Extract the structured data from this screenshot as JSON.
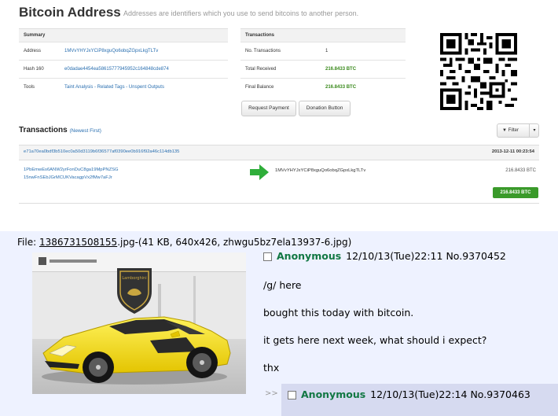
{
  "btc": {
    "title": "Bitcoin Address",
    "subtitle": "Addresses are identifiers which you use to send bitcoins to another person.",
    "summary": {
      "header": "Summary",
      "rows": [
        {
          "label": "Address",
          "value": "1MVvYHYJxYCiP8xguQo6obqZGpxLkgTLTv"
        },
        {
          "label": "Hash 160",
          "value": "e0dadae4454ea58615777945952c164848cde874"
        },
        {
          "label": "Tools",
          "value": "Taint Analysis - Related Tags - Unspent Outputs"
        }
      ]
    },
    "transactions_summary": {
      "header": "Transactions",
      "rows": [
        {
          "label": "No. Transactions",
          "value": "1"
        },
        {
          "label": "Total Received",
          "value": "216.8433 BTC"
        },
        {
          "label": "Final Balance",
          "value": "216.8433 BTC"
        }
      ]
    },
    "buttons": {
      "request_payment": "Request Payment",
      "donation_button": "Donation Button"
    },
    "tx_section": {
      "title": "Transactions",
      "newest": "(Newest First)",
      "filter_label": "Filter"
    },
    "tx": {
      "hash": "e71a70ea0bdf3b510ec0a50d3119b6f36577af0390ee0b916f92a46c114db135",
      "date": "2013-12-11 00:23:54",
      "inputs": [
        "1PbEmwEs6ANW2yrFonDuC8ga19MpPNZSG",
        "15nwFnSEbJGrMCUKVacagpVx2fMw7aFJr"
      ],
      "output": "1MVvYHYJxYCiP8xguQo6obqZGpxLkgTLTv",
      "amount": "216.8433 BTC",
      "badge": "216.8433 BTC"
    },
    "colors": {
      "link": "#2a6fb0",
      "green": "#3a9a2a"
    }
  },
  "chan": {
    "file_prefix": "File: ",
    "file_name": "1386731508155",
    "file_rest": ".jpg-(41 KB, 640x426, zhwgu5bz7ela13937-6.jpg)",
    "post": {
      "name": "Anonymous",
      "datetime": "12/10/13(Tue)22:11",
      "number": "No.9370452",
      "lines": [
        "/g/ here",
        "bought this today with bitcoin.",
        "it gets here next week, what should i expect?",
        "thx"
      ]
    },
    "reply": {
      "arrows": ">>",
      "name": "Anonymous",
      "datetime": "12/10/13(Tue)22:14",
      "number": "No.9370463"
    },
    "photo_sign": "Lamborghini",
    "colors": {
      "background": "#eef2ff",
      "name": "#117743",
      "reply_bg": "#d6daf0"
    }
  }
}
